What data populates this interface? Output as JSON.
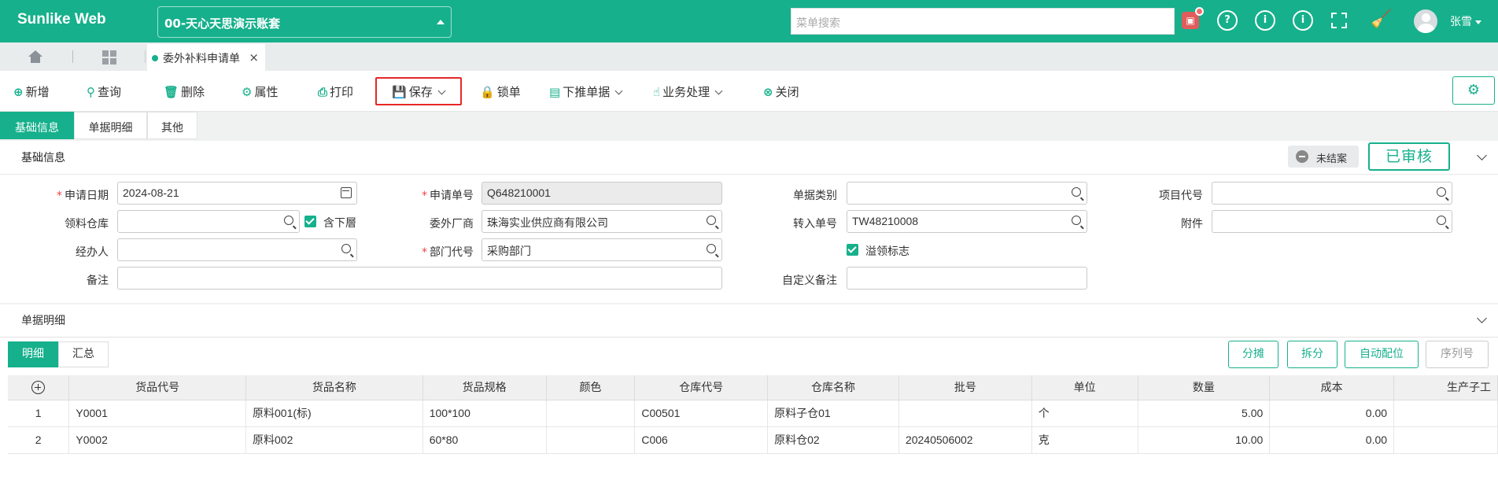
{
  "app": {
    "brand": "Sunlike Web",
    "account": "00-天心天思演示账套"
  },
  "header": {
    "search_placeholder": "菜单搜索",
    "user_name": "张雪"
  },
  "tabs": {
    "doc_tab": "委外补料申请单"
  },
  "toolbar": {
    "add": "新增",
    "query": "查询",
    "delete": "删除",
    "props": "属性",
    "print": "打印",
    "save": "保存",
    "lock": "锁单",
    "push": "下推单据",
    "business": "业务处理",
    "close": "关闭"
  },
  "subtabs": [
    "基础信息",
    "单据明细",
    "其他"
  ],
  "basic": {
    "title": "基础信息",
    "status_open": "未结案",
    "status_approved": "已审核",
    "labels": {
      "apply_date": "申请日期",
      "apply_no": "申请单号",
      "doc_type": "单据类别",
      "project_code": "项目代号",
      "warehouse": "领料仓库",
      "include_sub": "含下層",
      "vendor": "委外厂商",
      "transfer_no": "转入单号",
      "attachment": "附件",
      "handler": "经办人",
      "dept_code": "部门代号",
      "overflow_flag": "溢领标志",
      "remark": "备注",
      "custom_remark": "自定义备注"
    },
    "values": {
      "apply_date": "2024-08-21",
      "apply_no": "Q648210001",
      "doc_type": "",
      "project_code": "",
      "warehouse": "",
      "vendor": "珠海实业供应商有限公司",
      "transfer_no": "TW48210008",
      "attachment": "",
      "handler": "",
      "dept_code": "采购部门",
      "remark": "",
      "custom_remark": ""
    }
  },
  "detail": {
    "title": "单据明细",
    "segments": [
      "明细",
      "汇总"
    ],
    "actions": {
      "split_alloc": "分摊",
      "split": "拆分",
      "auto_match": "自动配位",
      "serial": "序列号"
    },
    "columns": [
      "货品代号",
      "货品名称",
      "货品规格",
      "颜色",
      "仓库代号",
      "仓库名称",
      "批号",
      "单位",
      "数量",
      "成本",
      "生产子工"
    ],
    "rows": [
      {
        "no": "1",
        "code": "Y0001",
        "name": "原料001(标)",
        "spec": "100*100",
        "color": "",
        "wh_code": "C00501",
        "wh_name": "原料子仓01",
        "lot": "",
        "unit": "个",
        "qty": "5.00",
        "cost": "0.00",
        "sub": ""
      },
      {
        "no": "2",
        "code": "Y0002",
        "name": "原料002",
        "spec": "60*80",
        "color": "",
        "wh_code": "C006",
        "wh_name": "原料仓02",
        "lot": "20240506002",
        "unit": "克",
        "qty": "10.00",
        "cost": "0.00",
        "sub": ""
      }
    ]
  }
}
